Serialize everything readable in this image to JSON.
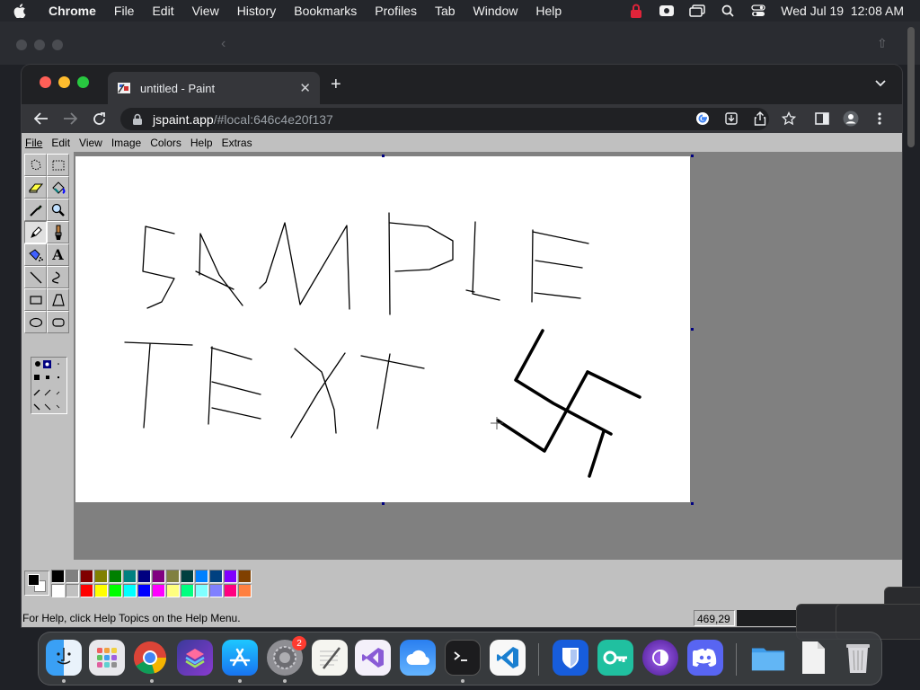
{
  "menubar": {
    "app_name": "Chrome",
    "items": [
      "File",
      "Edit",
      "View",
      "History",
      "Bookmarks",
      "Profiles",
      "Tab",
      "Window",
      "Help"
    ],
    "clock": "Wed Jul 19  12:08 AM"
  },
  "browser": {
    "tab_title": "untitled - Paint",
    "url_host": "jspaint.app",
    "url_path": "/#local:646c4e20f137"
  },
  "paint": {
    "menu": [
      "File",
      "Edit",
      "View",
      "Image",
      "Colors",
      "Help",
      "Extras"
    ],
    "status_text": "For Help, click Help Topics on the Help Menu.",
    "cursor_position": "469,29",
    "palette_row1": [
      "#000000",
      "#808080",
      "#800000",
      "#808000",
      "#008000",
      "#008080",
      "#000080",
      "#800080",
      "#808040",
      "#004040",
      "#0080ff",
      "#004080",
      "#8000ff",
      "#804000"
    ],
    "palette_row2": [
      "#ffffff",
      "#c0c0c0",
      "#ff0000",
      "#ffff00",
      "#00ff00",
      "#00ffff",
      "#0000ff",
      "#ff00ff",
      "#ffff80",
      "#00ff80",
      "#80ffff",
      "#8080ff",
      "#ff0080",
      "#ff8040"
    ],
    "foreground_color": "#000000",
    "background_color": "#ffffff",
    "tools": [
      "free-form-select",
      "select",
      "eraser",
      "fill",
      "pick-color",
      "magnifier",
      "pencil",
      "brush",
      "airbrush",
      "text",
      "line",
      "curve",
      "rectangle",
      "polygon",
      "ellipse",
      "rounded-rectangle"
    ],
    "active_tool": "pencil"
  },
  "dock": {
    "apps": [
      "Finder",
      "Launchpad",
      "Google Chrome",
      "Shortcuts",
      "App Store",
      "System Settings",
      "TextEdit",
      "Visual Studio",
      "Weather",
      "Terminal",
      "VS Code",
      "Bitwarden",
      "Keys",
      "Tor Browser",
      "Discord",
      "Folder",
      "Document",
      "Trash"
    ],
    "settings_badge": "2"
  }
}
